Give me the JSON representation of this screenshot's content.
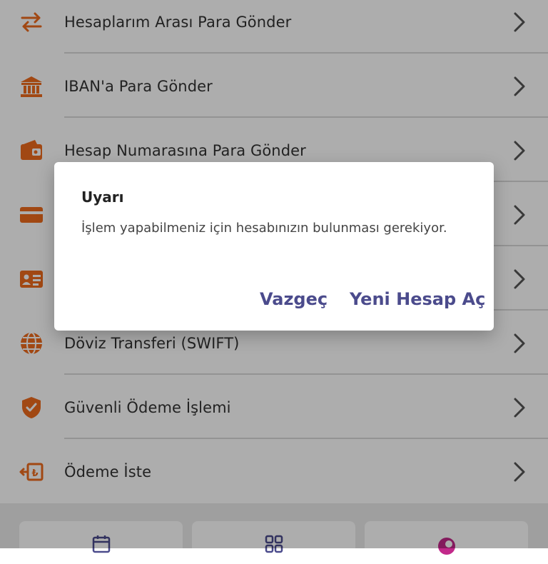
{
  "menu": {
    "items": [
      {
        "label": "Hesaplarım Arası Para Gönder",
        "icon": "transfer-arrows-icon"
      },
      {
        "label": "IBAN'a Para Gönder",
        "icon": "bank-icon"
      },
      {
        "label": "Hesap Numarasına Para Gönder",
        "icon": "wallet-icon"
      },
      {
        "label": "",
        "icon": "credit-card-icon"
      },
      {
        "label": "",
        "icon": "id-card-icon"
      },
      {
        "label": "Döviz Transferi (SWIFT)",
        "icon": "globe-icon"
      },
      {
        "label": "Güvenli Ödeme İşlemi",
        "icon": "shield-check-icon"
      },
      {
        "label": "Ödeme İste",
        "icon": "lira-request-icon"
      }
    ]
  },
  "dialog": {
    "title": "Uyarı",
    "message": "İşlem yapabilmeniz için hesabınızın bulunması gerekiyor.",
    "cancel_label": "Vazgeç",
    "confirm_label": "Yeni Hesap Aç"
  },
  "colors": {
    "icon_accent": "#ee6a1c",
    "dialog_button": "#4b4b8c",
    "overlay": "rgba(0,0,0,0.32)"
  },
  "bottom_cards": [
    {
      "icon": "calendar-icon"
    },
    {
      "icon": "qr-code-icon"
    },
    {
      "icon": "brand-logo-icon"
    }
  ]
}
